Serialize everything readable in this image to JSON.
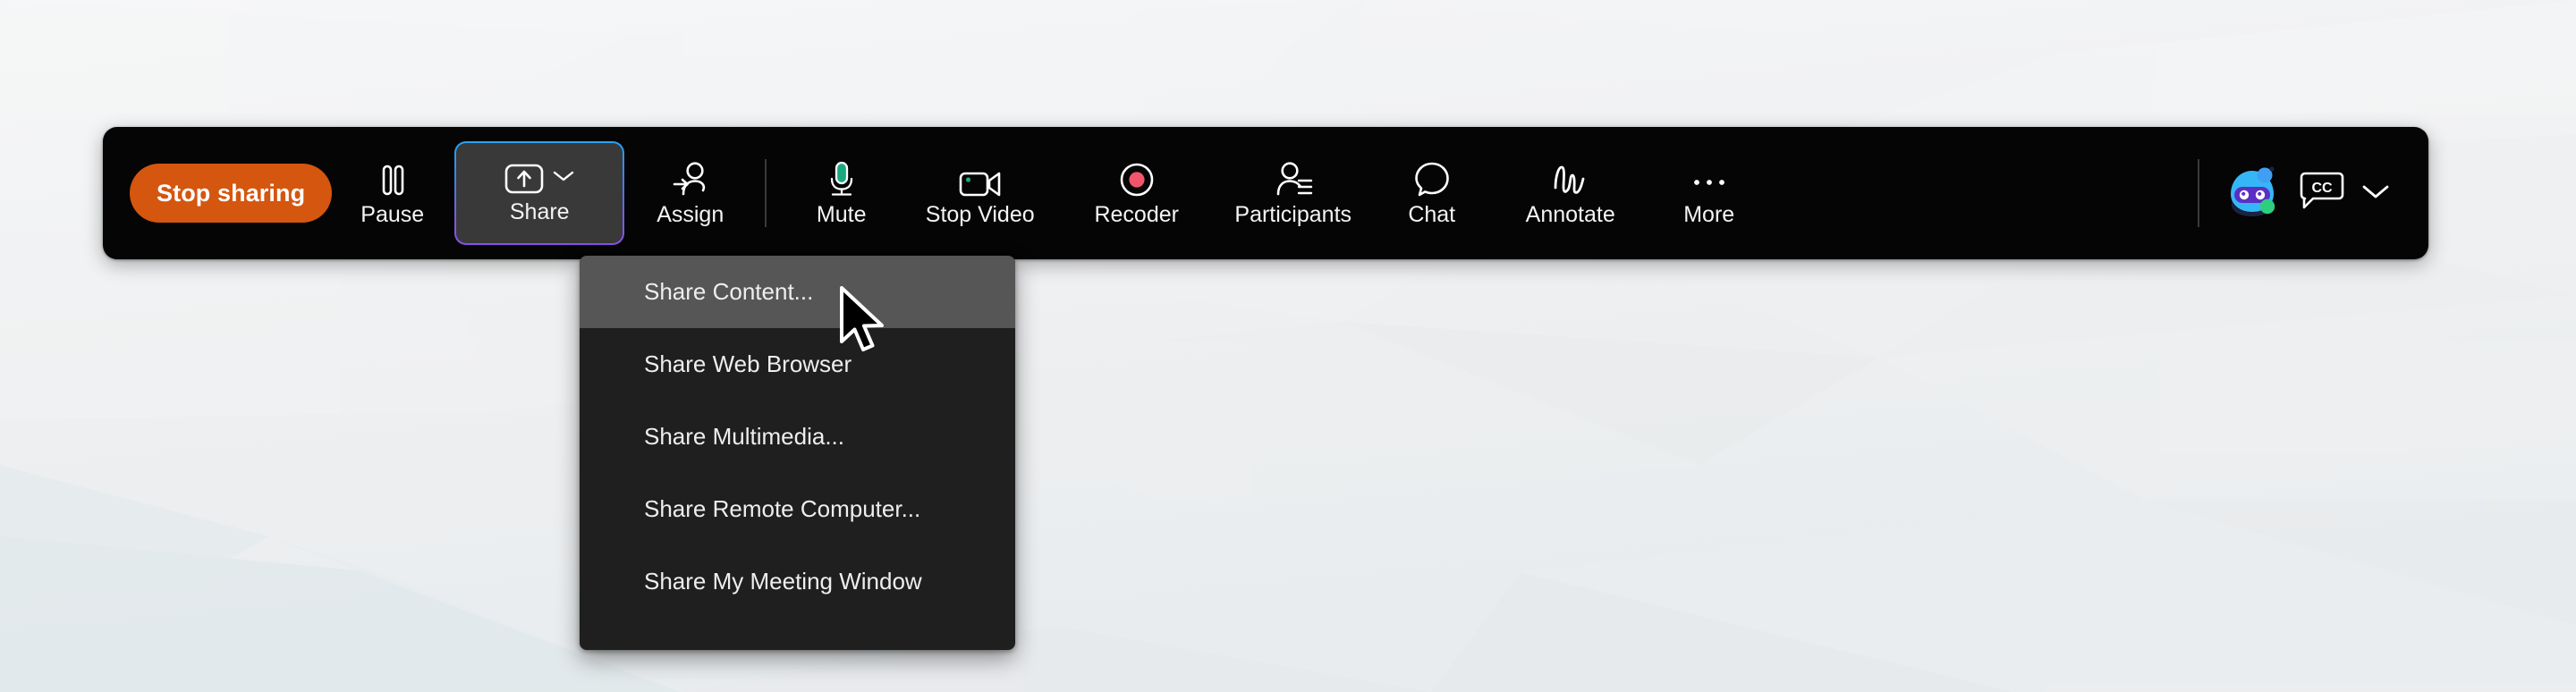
{
  "app": {
    "background_color": "#f2f3f4",
    "toolbar_color": "#050505",
    "accent_orange": "#d4560f",
    "share_border_gradient_start": "#29a2f0",
    "share_border_gradient_end": "#8b4fe8",
    "menu_color": "#1f1f1f",
    "menu_highlight_color": "#565656",
    "mic_green": "#1aa97f",
    "record_red": "#f2556b",
    "cc_chevron": "chevron-down-icon"
  },
  "toolbar": {
    "stop_sharing_label": "Stop sharing",
    "items": [
      {
        "label": "Pause",
        "icon": "pause-icon"
      },
      {
        "label": "Share",
        "icon": "share-upload-icon",
        "active": true,
        "has_chevron": true
      },
      {
        "label": "Assign",
        "icon": "assign-person-icon"
      },
      {
        "label": "Mute",
        "icon": "microphone-icon"
      },
      {
        "label": "Stop Video",
        "icon": "video-camera-icon"
      },
      {
        "label": "Recoder",
        "icon": "record-circle-icon"
      },
      {
        "label": "Participants",
        "icon": "participants-icon"
      },
      {
        "label": "Chat",
        "icon": "chat-bubble-icon"
      },
      {
        "label": "Annotate",
        "icon": "annotate-squiggle-icon"
      },
      {
        "label": "More",
        "icon": "ellipsis-icon"
      }
    ],
    "right_icons": [
      {
        "name": "ai-assistant-bot-icon"
      },
      {
        "name": "closed-captions-icon",
        "text": "CC"
      }
    ]
  },
  "share_menu": {
    "items": [
      {
        "label": "Share Content...",
        "highlighted": true
      },
      {
        "label": "Share Web Browser",
        "highlighted": false
      },
      {
        "label": "Share Multimedia...",
        "highlighted": false
      },
      {
        "label": "Share Remote Computer...",
        "highlighted": false
      },
      {
        "label": "Share My Meeting Window",
        "highlighted": false
      }
    ]
  }
}
